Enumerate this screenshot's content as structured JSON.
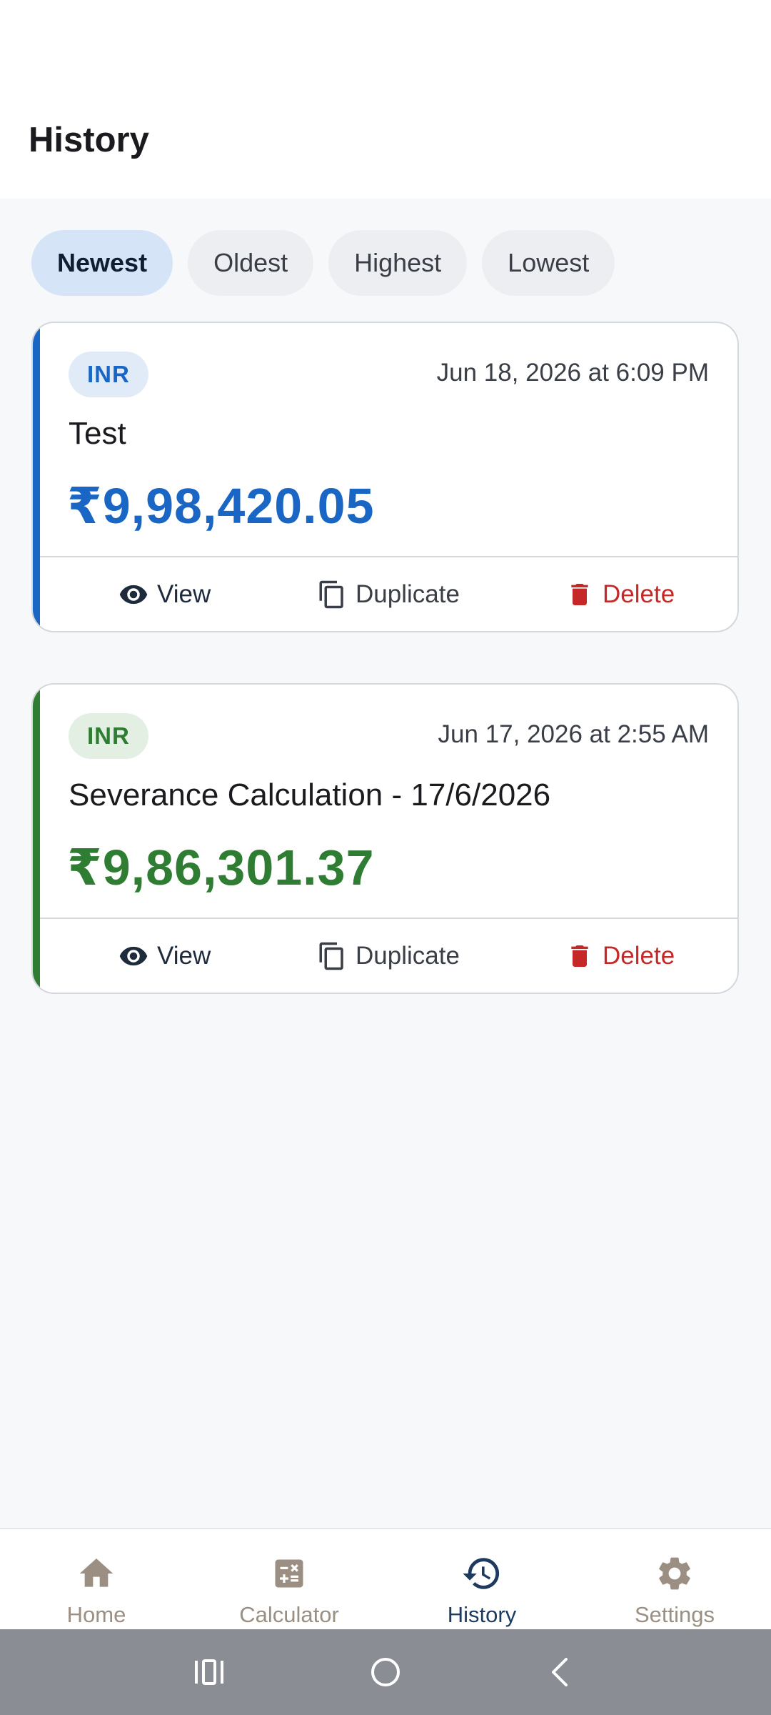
{
  "header": {
    "title": "History"
  },
  "filters": [
    {
      "label": "Newest",
      "active": true
    },
    {
      "label": "Oldest",
      "active": false
    },
    {
      "label": "Highest",
      "active": false
    },
    {
      "label": "Lowest",
      "active": false
    }
  ],
  "cards": [
    {
      "currency": "INR",
      "date": "Jun 18, 2026 at 6:09 PM",
      "name": "Test",
      "amount": "₹9,98,420.05",
      "accent_color": "#1a66c5"
    },
    {
      "currency": "INR",
      "date": "Jun 17, 2026 at 2:55 AM",
      "name": "Severance Calculation - 17/6/2026",
      "amount": "₹9,86,301.37",
      "accent_color": "#2e7d32"
    }
  ],
  "actions": {
    "view": "View",
    "duplicate": "Duplicate",
    "delete": "Delete"
  },
  "bottom_nav": {
    "items": [
      {
        "label": "Home",
        "icon": "home-icon",
        "active": false
      },
      {
        "label": "Calculator",
        "icon": "calculator-icon",
        "active": false
      },
      {
        "label": "History",
        "icon": "history-icon",
        "active": true
      },
      {
        "label": "Settings",
        "icon": "gear-icon",
        "active": false
      }
    ]
  },
  "system_nav": {
    "icons": [
      "recent-apps-icon",
      "home-circle-icon",
      "back-icon"
    ]
  }
}
